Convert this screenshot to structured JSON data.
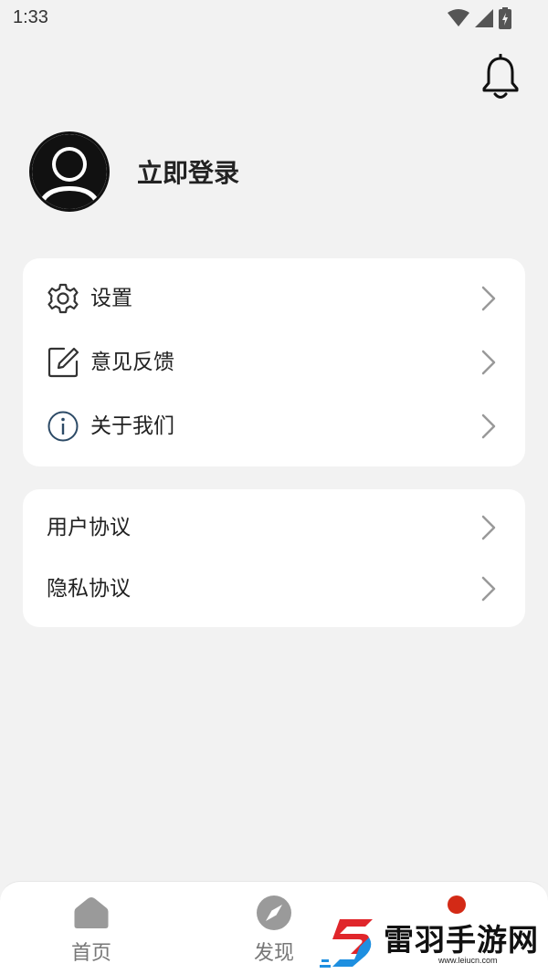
{
  "status_bar": {
    "time": "1:33"
  },
  "profile": {
    "login_label": "立即登录"
  },
  "menu_card": {
    "items": [
      {
        "label": "设置",
        "icon": "gear-icon"
      },
      {
        "label": "意见反馈",
        "icon": "edit-icon"
      },
      {
        "label": "关于我们",
        "icon": "info-icon"
      }
    ]
  },
  "legal_card": {
    "items": [
      {
        "label": "用户协议"
      },
      {
        "label": "隐私协议"
      }
    ]
  },
  "tabbar": {
    "tabs": [
      {
        "label": "首页",
        "icon": "home-icon"
      },
      {
        "label": "发现",
        "icon": "compass-icon"
      }
    ]
  },
  "watermark": {
    "text": "雷羽手游网",
    "url": "www.leiucn.com"
  },
  "colors": {
    "background": "#f2f2f2",
    "card": "#ffffff",
    "badge": "#d32a16",
    "tab_text": "#777777"
  }
}
